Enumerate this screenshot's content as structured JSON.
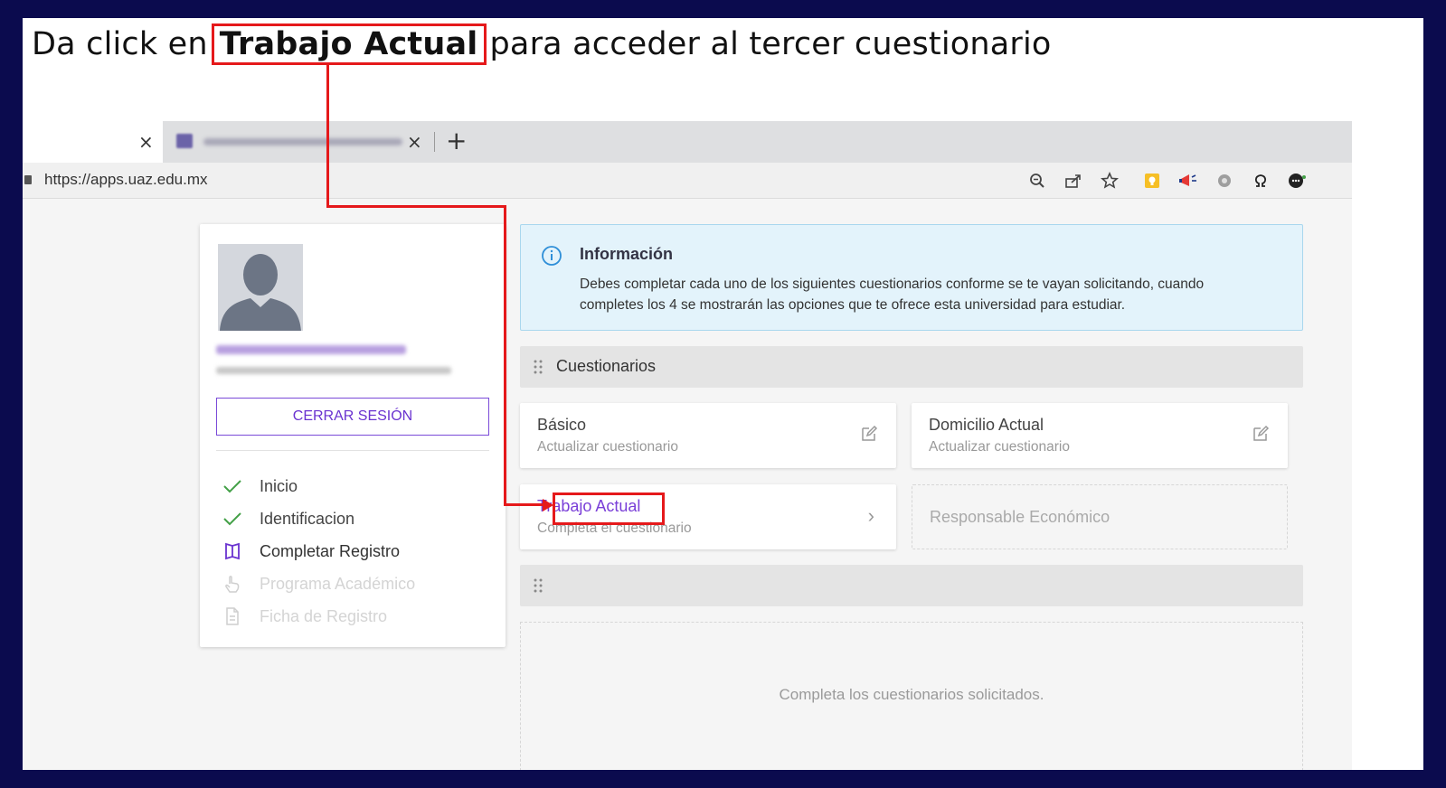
{
  "instruction": {
    "before": "Da click en",
    "highlight": "Trabajo Actual",
    "after": "para acceder al tercer cuestionario"
  },
  "browser": {
    "url": "https://apps.uaz.edu.mx",
    "tab_close": "×",
    "new_tab": "+"
  },
  "sidebar": {
    "logout_label": "CERRAR SESIÓN",
    "menu": [
      {
        "label": "Inicio",
        "icon": "check-icon",
        "state": "done"
      },
      {
        "label": "Identificacion",
        "icon": "check-icon",
        "state": "done"
      },
      {
        "label": "Completar Registro",
        "icon": "book-icon",
        "state": "current"
      },
      {
        "label": "Programa Académico",
        "icon": "hand-pointer-icon",
        "state": "disabled"
      },
      {
        "label": "Ficha de Registro",
        "icon": "document-icon",
        "state": "disabled"
      }
    ]
  },
  "info": {
    "title": "Información",
    "text": "Debes completar cada uno de los siguientes cuestionarios conforme se te vayan solicitando, cuando completes los 4 se mostrarán las opciones que te ofrece esta universidad para estudiar."
  },
  "section": {
    "title": "Cuestionarios",
    "cards": [
      {
        "title": "Básico",
        "subtitle": "Actualizar cuestionario"
      },
      {
        "title": "Domicilio Actual",
        "subtitle": "Actualizar cuestionario"
      },
      {
        "title": "Trabajo Actual",
        "subtitle": "Completa el cuestionario"
      },
      {
        "title": "Responsable Económico"
      }
    ]
  },
  "empty_state": "Completa los cuestionarios solicitados.",
  "colors": {
    "accent": "#7a3fd8",
    "annotation_red": "#e5191b",
    "check_green": "#43a047",
    "info_bg": "#e3f3fb",
    "slide_border": "#0b0b4e"
  }
}
